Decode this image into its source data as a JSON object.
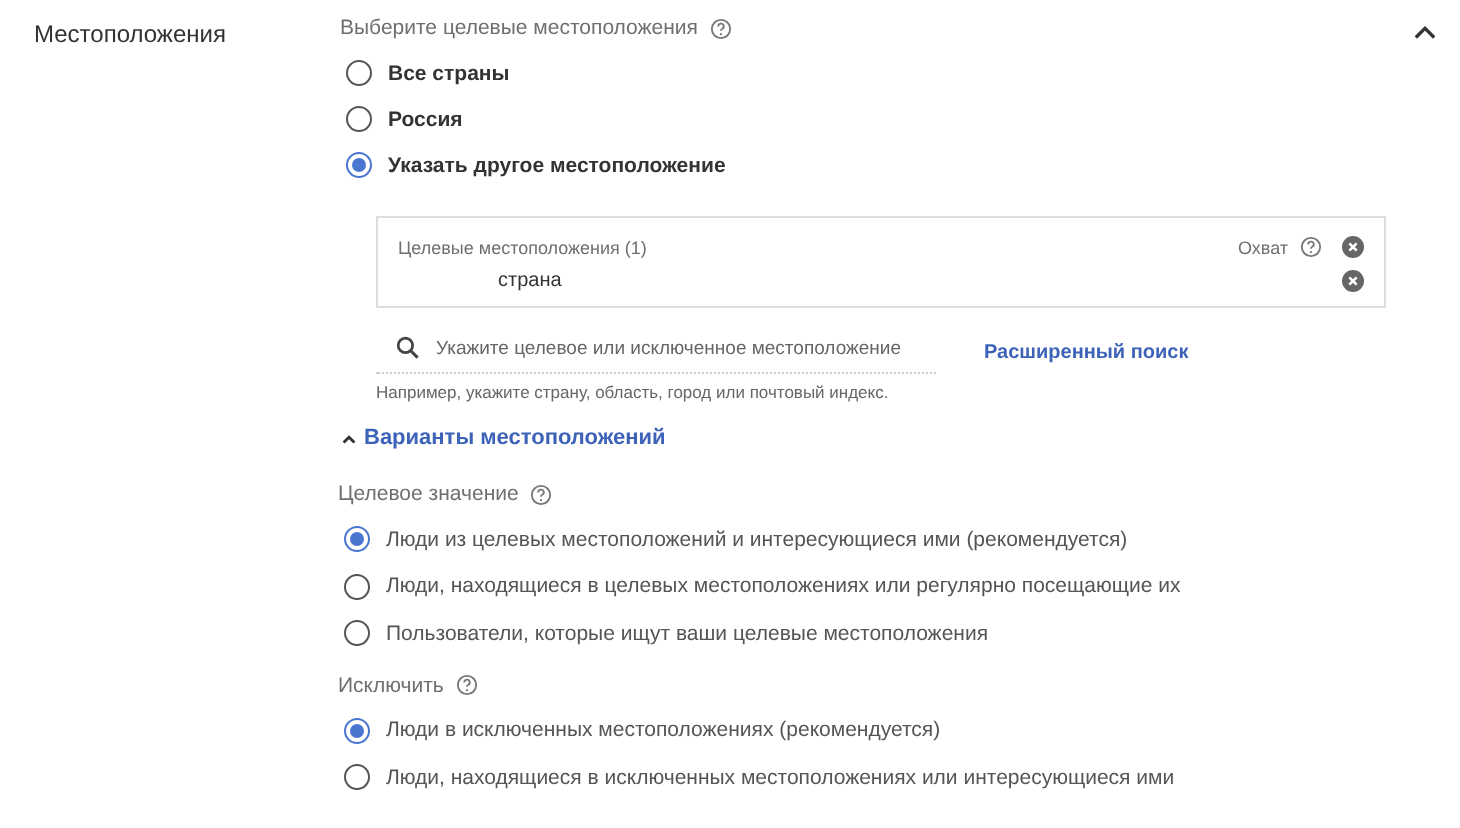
{
  "section": {
    "title": "Местоположения",
    "expanded": true
  },
  "target_prompt": "Выберите целевые местоположения",
  "target_options": [
    {
      "label": "Все страны",
      "selected": false
    },
    {
      "label": "Россия",
      "selected": false
    },
    {
      "label": "Указать другое местоположение",
      "selected": true
    }
  ],
  "locations_box": {
    "title": "Целевые местоположения (1)",
    "reach_label": "Охват",
    "rows": [
      {
        "name": "страна"
      }
    ]
  },
  "search": {
    "placeholder": "Укажите целевое или исключенное местоположение",
    "hint": "Например, укажите страну, область, город или почтовый индекс.",
    "advanced_link": "Расширенный поиск"
  },
  "options_toggle": {
    "label": "Варианты местоположений",
    "expanded": true
  },
  "groups": [
    {
      "title": "Целевое значение",
      "options": [
        {
          "label": "Люди из целевых местоположений и интересующиеся ими (рекомендуется)",
          "selected": true
        },
        {
          "label": "Люди, находящиеся в целевых местоположениях или регулярно посещающие их",
          "selected": false
        },
        {
          "label": "Пользователи, которые ищут ваши целевые местоположения",
          "selected": false
        }
      ]
    },
    {
      "title": "Исключить",
      "options": [
        {
          "label": "Люди в исключенных местоположениях (рекомендуется)",
          "selected": true
        },
        {
          "label": "Люди, находящиеся в исключенных местоположениях или интересующиеся ими",
          "selected": false
        }
      ]
    }
  ]
}
